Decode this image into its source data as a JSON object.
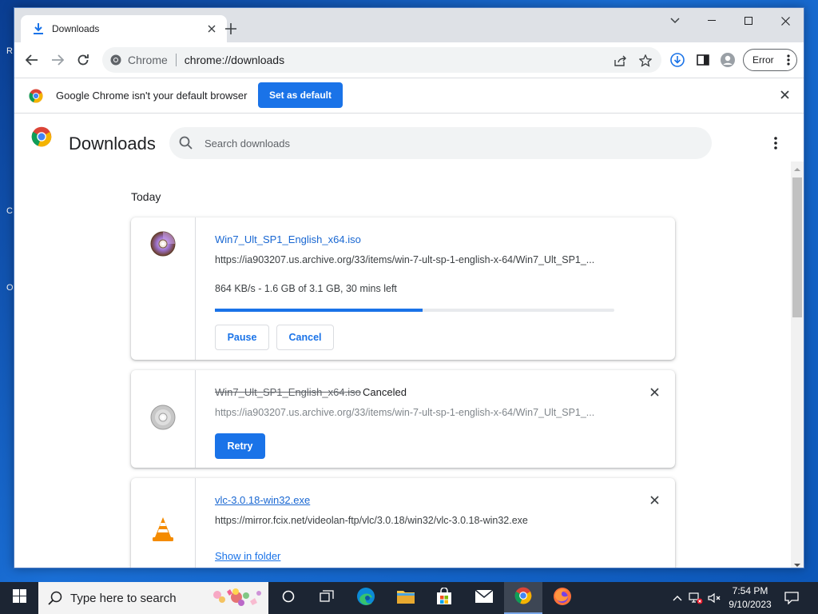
{
  "browser": {
    "tab": {
      "title": "Downloads"
    },
    "omnibox": {
      "site_label": "Chrome",
      "url": "chrome://downloads"
    },
    "profile_status": "Error"
  },
  "infobar": {
    "message": "Google Chrome isn't your default browser",
    "button_label": "Set as default"
  },
  "downloads_page": {
    "title": "Downloads",
    "search_placeholder": "Search downloads",
    "date_header": "Today",
    "items": [
      {
        "filename": "Win7_Ult_SP1_English_x64.iso",
        "url": "https://ia903207.us.archive.org/33/items/win-7-ult-sp-1-english-x-64/Win7_Ult_SP1_...",
        "progress_text": "864 KB/s - 1.6 GB of 3.1 GB, 30 mins left",
        "progress_fraction": 0.52,
        "buttons": [
          "Pause",
          "Cancel"
        ]
      },
      {
        "filename": "Win7_Ult_SP1_English_x64.iso",
        "status": "Canceled",
        "url": "https://ia903207.us.archive.org/33/items/win-7-ult-sp-1-english-x-64/Win7_Ult_SP1_...",
        "buttons": [
          "Retry"
        ]
      },
      {
        "filename": "vlc-3.0.18-win32.exe",
        "url": "https://mirror.fcix.net/videolan-ftp/vlc/3.0.18/win32/vlc-3.0.18-win32.exe",
        "link_label": "Show in folder"
      }
    ]
  },
  "taskbar": {
    "search_placeholder": "Type here to search",
    "clock_time": "7:54 PM",
    "clock_date": "9/10/2023"
  },
  "colors": {
    "accent": "#1a73e8",
    "taskbar": "#1c2533",
    "desktop": "#1565c0"
  }
}
